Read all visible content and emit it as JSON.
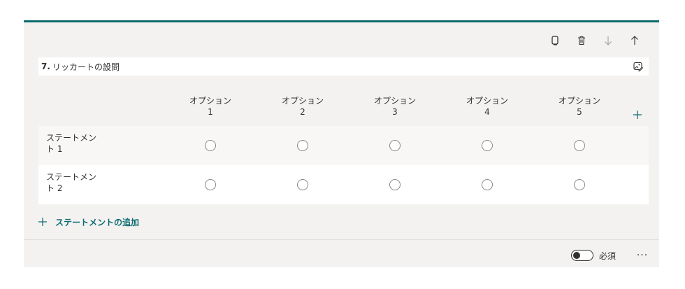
{
  "question": {
    "number": "7.",
    "title": "リッカートの設問"
  },
  "toolbar": {
    "copy_icon": "copy-icon",
    "delete_icon": "trash-icon",
    "down_icon": "arrow-down-icon",
    "up_icon": "arrow-up-icon"
  },
  "options": [
    {
      "label": "オプション",
      "num": "1"
    },
    {
      "label": "オプション",
      "num": "2"
    },
    {
      "label": "オプション",
      "num": "3"
    },
    {
      "label": "オプション",
      "num": "4"
    },
    {
      "label": "オプション",
      "num": "5"
    }
  ],
  "statements": [
    {
      "label": "ステートメント 1"
    },
    {
      "label": "ステートメント 2"
    }
  ],
  "add_statement_label": "ステートメントの追加",
  "footer": {
    "required_label": "必須",
    "required_on": false,
    "more_label": "···"
  },
  "colors": {
    "accent": "#0b6a6e",
    "card_bg": "#f3f2f1"
  }
}
